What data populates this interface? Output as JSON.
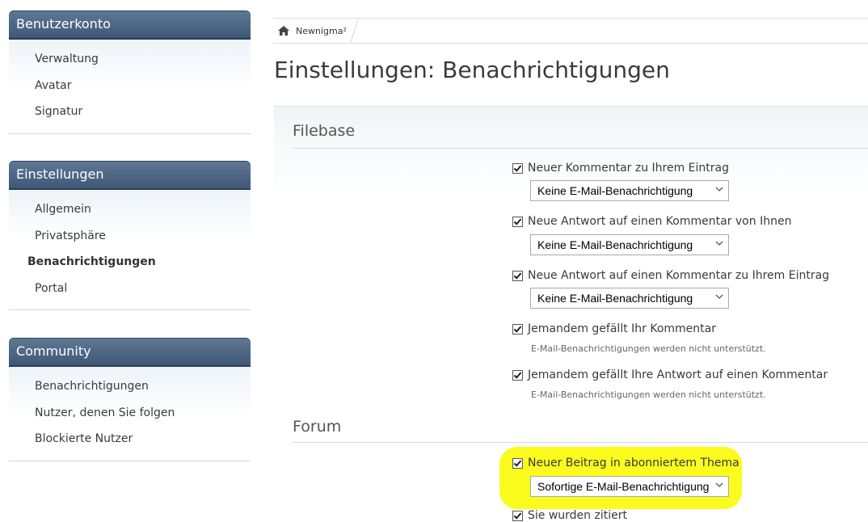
{
  "sidebar": {
    "sections": [
      {
        "title": "Benutzerkonto",
        "items": [
          "Verwaltung",
          "Avatar",
          "Signatur"
        ]
      },
      {
        "title": "Einstellungen",
        "items": [
          "Allgemein",
          "Privatsphäre",
          "Benachrichtigungen",
          "Portal"
        ]
      },
      {
        "title": "Community",
        "items": [
          "Benachrichtigungen",
          "Nutzer, denen Sie folgen",
          "Blockierte Nutzer"
        ]
      }
    ],
    "active_item": "Benachrichtigungen"
  },
  "breadcrumb": {
    "home_label": "Newnigma²",
    "icon": "home-icon"
  },
  "page_title": "Einstellungen: Benachrichtigungen",
  "filebase": {
    "heading": "Filebase",
    "options": [
      {
        "label": "Neuer Kommentar zu Ihrem Eintrag",
        "checked": true,
        "select": "Keine E-Mail-Benachrichtigung"
      },
      {
        "label": "Neue Antwort auf einen Kommentar von Ihnen",
        "checked": true,
        "select": "Keine E-Mail-Benachrichtigung"
      },
      {
        "label": "Neue Antwort auf einen Kommentar zu Ihrem Eintrag",
        "checked": true,
        "select": "Keine E-Mail-Benachrichtigung"
      },
      {
        "label": "Jemandem gefällt Ihr Kommentar",
        "checked": true,
        "note": "E-Mail-Benachrichtigungen werden nicht unterstützt."
      },
      {
        "label": "Jemandem gefällt Ihre Antwort auf einen Kommentar",
        "checked": true,
        "note": "E-Mail-Benachrichtigungen werden nicht unterstützt."
      }
    ]
  },
  "forum": {
    "heading": "Forum",
    "options": [
      {
        "label": "Neuer Beitrag in abonniertem Thema",
        "checked": true,
        "select": "Sofortige E-Mail-Benachrichtigung"
      },
      {
        "label": "Sie wurden zitiert",
        "checked": true
      }
    ]
  },
  "colors": {
    "sidebar_header": "#4a6281",
    "highlight": "#fbfb1e"
  }
}
